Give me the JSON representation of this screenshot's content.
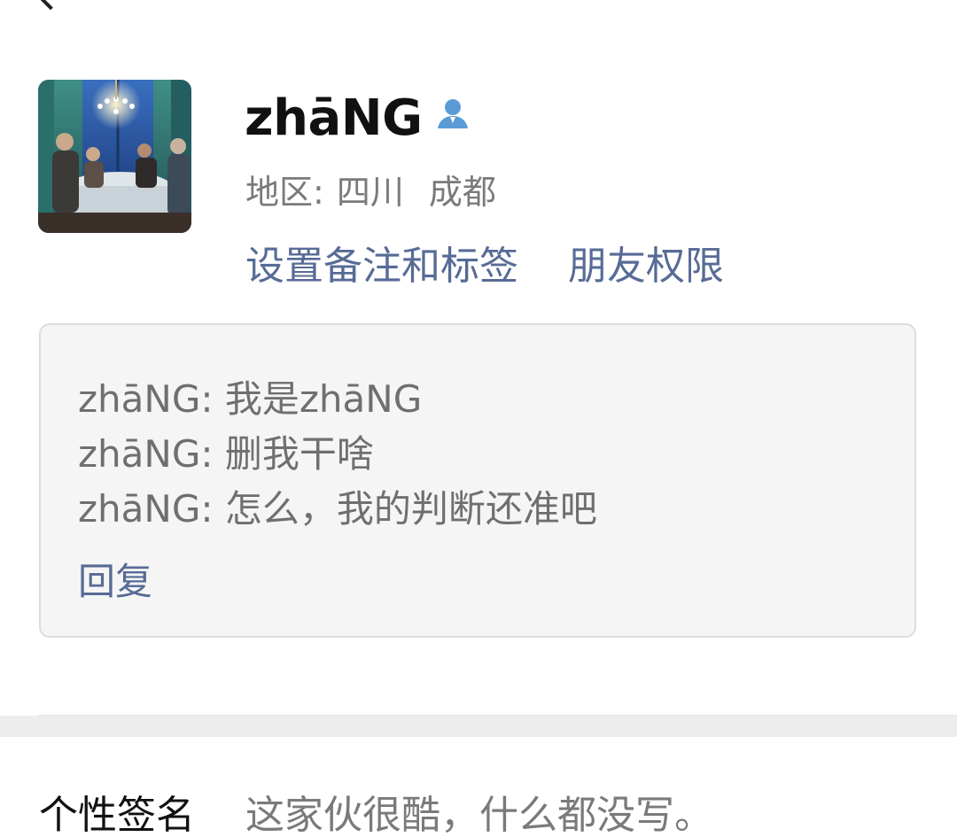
{
  "profile": {
    "nickname": "zhāNG",
    "region": {
      "label": "地区:",
      "province": "四川",
      "city": "成都"
    },
    "gender_icon": "person-icon",
    "links": {
      "remark": "设置备注和标签",
      "permissions": "朋友权限"
    }
  },
  "greeting": {
    "messages": [
      "zhāNG: 我是zhāNG",
      "zhāNG: 删我干啥",
      "zhāNG: 怎么，我的判断还准吧"
    ],
    "reply_label": "回复"
  },
  "signature": {
    "label": "个性签名",
    "value": "这家伙很酷，什么都没写。"
  },
  "colors": {
    "link": "#576b95",
    "gender_icon": "#5b9bd5",
    "card_bg": "#f5f5f5"
  }
}
